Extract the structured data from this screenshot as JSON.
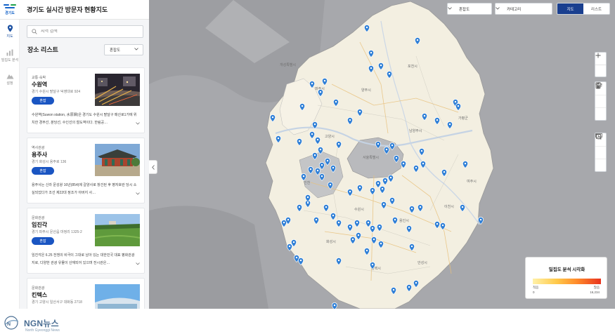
{
  "app": {
    "title": "경기도 실시간 방문자 현황지도",
    "logo_text": "경기도"
  },
  "rail": [
    {
      "label": "지도",
      "icon": "map-pin-icon",
      "active": true
    },
    {
      "label": "밀집도 분석",
      "icon": "chart-icon",
      "active": false
    },
    {
      "label": "설정",
      "icon": "mountain-icon",
      "active": false
    }
  ],
  "sidebar": {
    "search_placeholder": "지역 검색",
    "list_title": "장소 리스트",
    "sort_label": "혼잡도",
    "cards": [
      {
        "category": "교통·숙박",
        "name": "수원역",
        "address": "경기 수원시 팔달구 덕영대로 924",
        "button": "혼잡",
        "desc": "수원역(Suwon station, 水原驛)은 경기도 수원시 팔달구 매산로1가에 위치한 경부선, 분당선, 수인선의 철도역이다. 한림공…"
      },
      {
        "category": "역사관광",
        "name": "용주사",
        "address": "경기 화성시 용주로 136",
        "button": "혼잡",
        "desc": "용주사는 신라 문성왕 16년(854)에 갈양사로 창건된 후 병자호란 당시 소실되었다가 조선 제22대 정조가 아버지 사…"
      },
      {
        "category": "문화관광",
        "name": "임진각",
        "address": "경기 파주시 문산읍 마정리 1325-2",
        "button": "혼잡",
        "desc": "임진각은 6.25 전쟁의 비극이 그대로 남아 있는 대한민국 대표 평화관광지로, 다양한 관광 유물이 산재되어 있으며 전시관은…"
      },
      {
        "category": "문화관광",
        "name": "킨텍스",
        "address": "경기 고양시 일산서구 대화동 2718",
        "button": "혼잡",
        "desc": ""
      }
    ]
  },
  "map": {
    "filter_1": "혼잡도",
    "filter_2": "카테고리",
    "view_map": "지도",
    "view_list": "리스트",
    "labels": [
      "개성특별시",
      "파주시",
      "양주시",
      "포천시",
      "가평군",
      "고양시",
      "서울특별시",
      "남양주시",
      "인천",
      "수원시",
      "용인시",
      "이천시",
      "안성시",
      "평택시",
      "화성시",
      "여주시"
    ],
    "marker_color": "#2f7fd6",
    "region_color": "#f3efe1"
  },
  "legend": {
    "title": "밀집도 분석 시각화",
    "low_label": "적음",
    "high_label": "많음",
    "min": "0",
    "max": "16,234"
  },
  "footer": {
    "brand": "NGN뉴스",
    "subtitle": "North Gyeonggi News"
  }
}
